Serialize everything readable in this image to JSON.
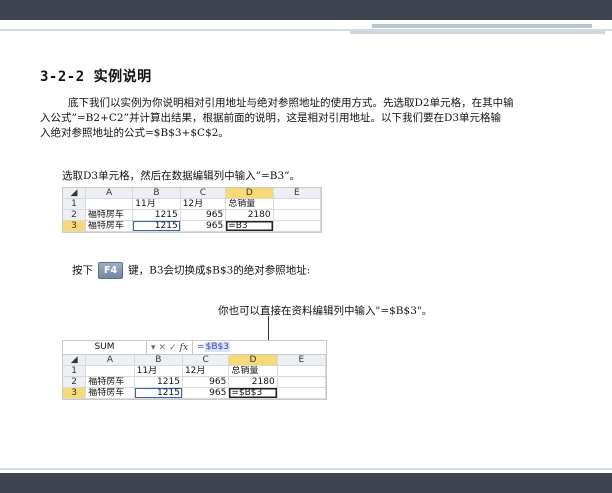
{
  "section_title": "3-2-2 实例说明",
  "paragraph_lines": [
    "底下我们以实例为你说明相对引用地址与绝对参照地址的使用方式。先选取D2单元格，在其中输",
    "入公式”=B2+C2”并计算出结果，根据前面的说明，这是相对引用地址。以下我们要在D3单元格输",
    "入绝对参照地址的公式=$B$3+$C$2。"
  ],
  "step1": "选取D3单元格，然后在数据编辑列中输入”=B3”。",
  "step2": {
    "before": "按下",
    "key": "F4",
    "after": "键，B3会切换成$B$3的绝对参照地址:"
  },
  "callout": "你也可以直接在资料编辑列中输入\"=$B$3\"。",
  "columns": [
    "A",
    "B",
    "C",
    "D",
    "E"
  ],
  "table1": {
    "rows": [
      {
        "num": "1",
        "a": "",
        "b": "11月",
        "c": "12月",
        "d": "总销量"
      },
      {
        "num": "2",
        "a": "福特房车",
        "b": "1215",
        "c": "965",
        "d": "2180"
      },
      {
        "num": "3",
        "a": "福特房车",
        "b": "1215",
        "c": "965",
        "d": "=B3"
      }
    ]
  },
  "table2": {
    "namebox": "SUM",
    "formula_prefix": "=",
    "formula_ref": "$B$3",
    "rows": [
      {
        "num": "1",
        "a": "",
        "b": "11月",
        "c": "12月",
        "d": "总销量"
      },
      {
        "num": "2",
        "a": "福特房车",
        "b": "1215",
        "c": "965",
        "d": "2180"
      },
      {
        "num": "3",
        "a": "福特房车",
        "b": "1215",
        "c": "965",
        "d": "=$B$3"
      }
    ]
  }
}
